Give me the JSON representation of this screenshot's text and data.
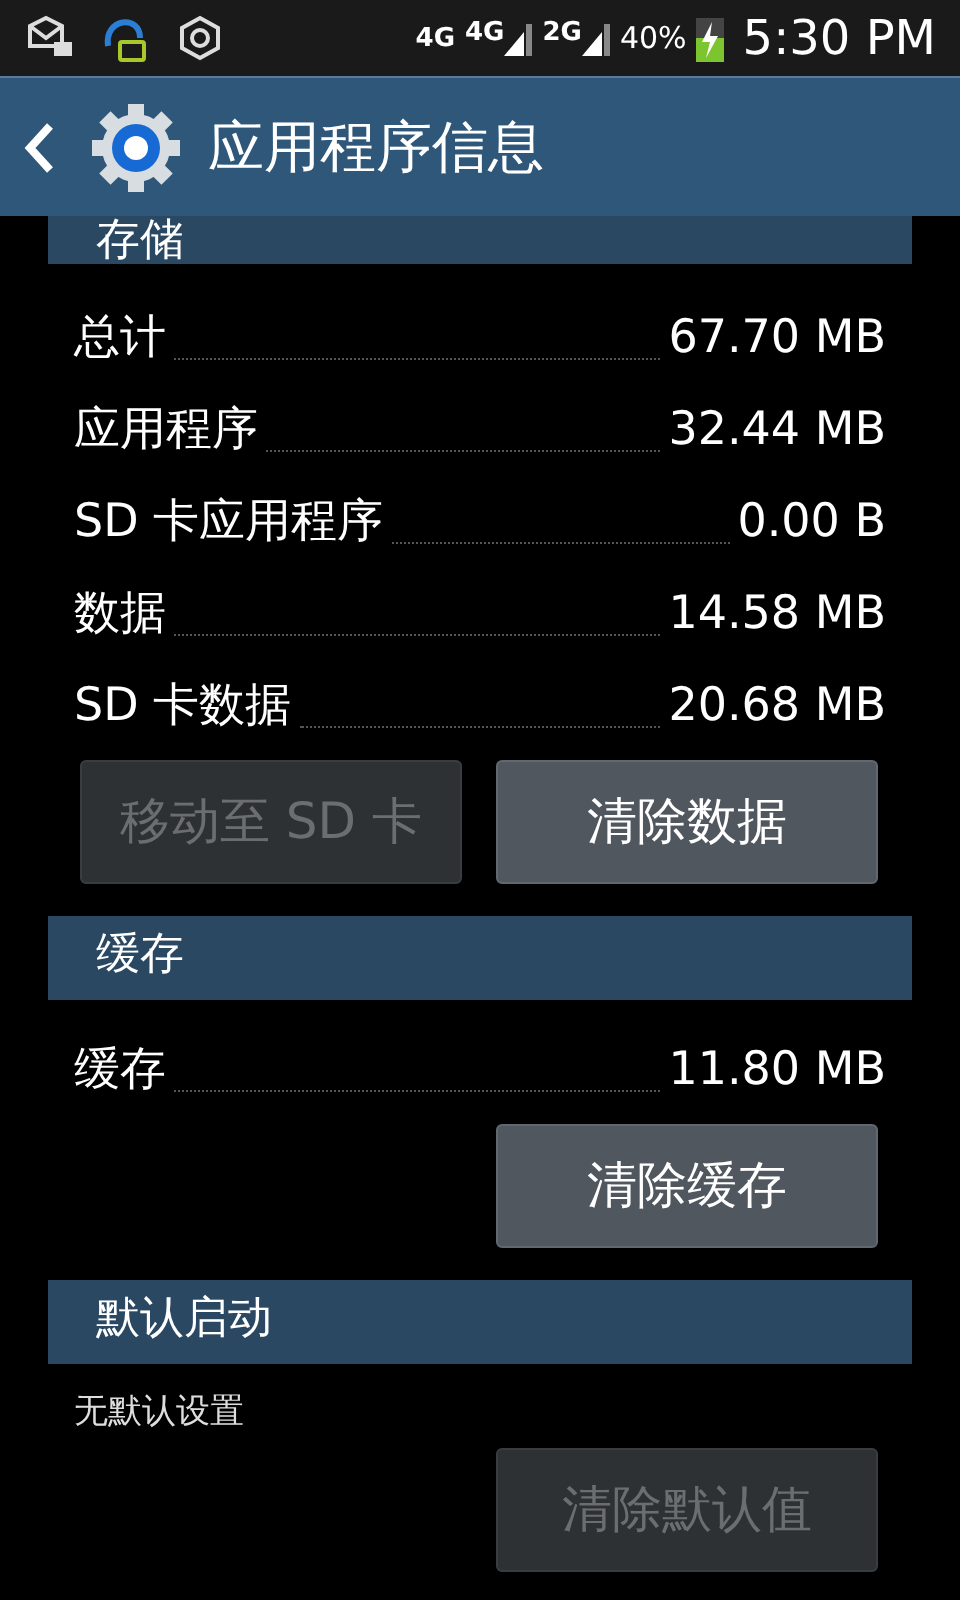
{
  "status_bar": {
    "network_labels": [
      "4G",
      "4G",
      "2G"
    ],
    "battery": "40%",
    "time": "5:30 PM"
  },
  "action_bar": {
    "title": "应用程序信息"
  },
  "sections": [
    {
      "title": "存储",
      "rows": [
        {
          "label": "总计",
          "value": "67.70 MB"
        },
        {
          "label": "应用程序",
          "value": "32.44 MB"
        },
        {
          "label": "SD 卡应用程序",
          "value": "0.00 B"
        },
        {
          "label": "数据",
          "value": "14.58 MB"
        },
        {
          "label": "SD 卡数据",
          "value": "20.68 MB"
        }
      ],
      "buttons": [
        {
          "label": "移动至 SD 卡",
          "disabled": true
        },
        {
          "label": "清除数据",
          "disabled": false
        }
      ]
    },
    {
      "title": "缓存",
      "rows": [
        {
          "label": "缓存",
          "value": "11.80 MB"
        }
      ],
      "buttons": [
        {
          "label": "清除缓存",
          "disabled": false
        }
      ]
    },
    {
      "title": "默认启动",
      "note": "无默认设置",
      "buttons": [
        {
          "label": "清除默认值",
          "disabled": true
        }
      ]
    }
  ]
}
